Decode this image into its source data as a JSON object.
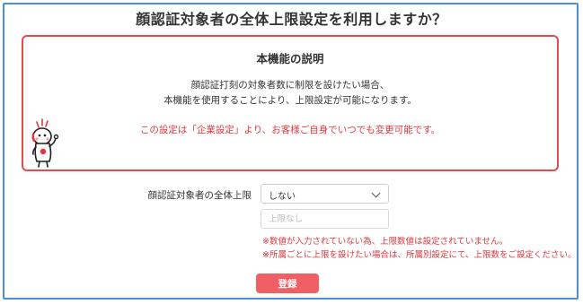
{
  "dialog": {
    "title": "顔認証対象者の全体上限設定を利用しますか？"
  },
  "info_box": {
    "heading": "本機能の説明",
    "description_line1": "顔認証打刻の対象者数に制限を設けたい場合、",
    "description_line2": "本機能を使用することにより、上限設定が可能になります。",
    "note": "この設定は「企業設定」より、お客様ご自身でいつでも変更可能です。"
  },
  "mascot": {
    "icon": "mascot-character-icon"
  },
  "form": {
    "label": "顔認証対象者の全体上限",
    "select_value": "しない",
    "input_placeholder": "上限なし",
    "warning_1": "※数値が入力されていない為、上限数値は設定されていません。",
    "warning_2": "※所属ごとに上限を設けたい場合は、所属別設定にて、上限数をご設定ください。"
  },
  "submit": {
    "label": "登録"
  },
  "colors": {
    "accent_red": "#e0383e",
    "button_red": "#ef5f64",
    "frame_blue": "#4a90d9"
  }
}
